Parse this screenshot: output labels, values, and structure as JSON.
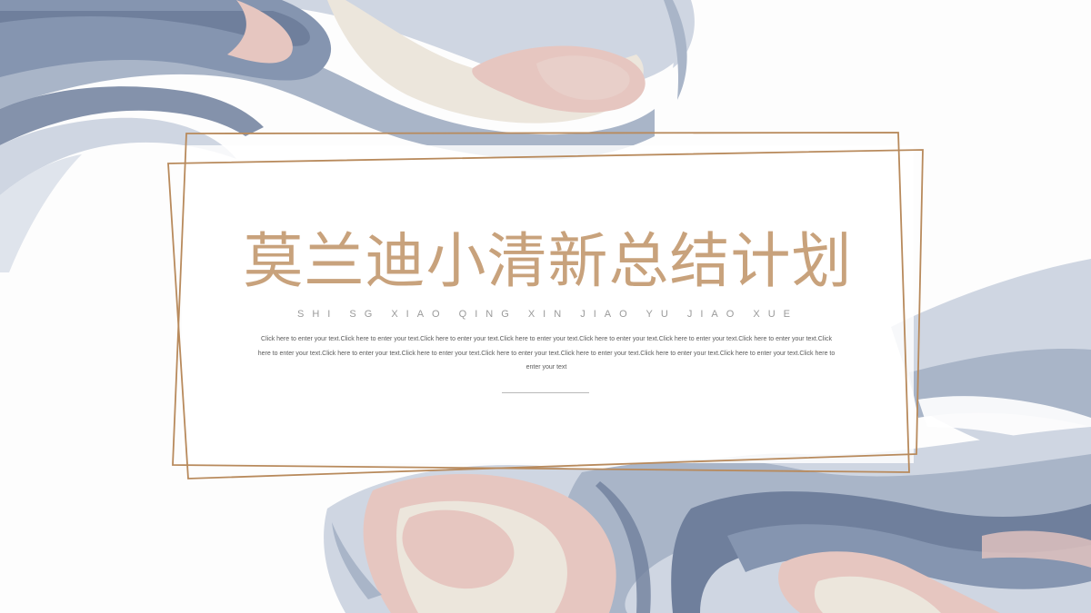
{
  "slide": {
    "title": "莫兰迪小清新总结计划",
    "pinyin": "SHI SG XIAO QING XIN JIAO YU JIAO XUE",
    "body": "Click here to enter your text.Click here to enter your text.Click here to enter your text.Click here to enter your text.Click here to enter your text.Click here to enter your text.Click here to enter your text.Click here to enter your text.Click here to enter your text.Click here to enter your text.Click here to enter your text.Click here to enter your text.Click here to enter your text.Click here to enter your text.Click here to enter your text"
  },
  "colors": {
    "gold": "#b88a5c",
    "title": "#c8a27c",
    "pinyin": "#9a9a9a",
    "slate": "#6f7f9c",
    "blue_gray": "#a9b5c8",
    "pale_blue": "#cfd6e2",
    "pink": "#e6c6c0",
    "cream": "#ece6dc"
  }
}
